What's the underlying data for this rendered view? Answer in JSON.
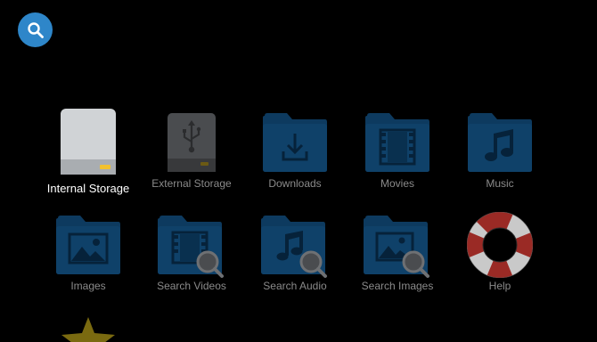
{
  "colors": {
    "background": "#000000",
    "search_button": "#2e86c9",
    "folder": "#0d3a5f",
    "folder_glyph": "#06223a",
    "label_dim": "#8a8a8a",
    "label_focused": "#ffffff",
    "star": "#7a6a10"
  },
  "toolbar": {
    "search_icon": "search-icon"
  },
  "tiles": [
    {
      "label": "Internal Storage",
      "icon": "internal-storage-icon",
      "focused": true
    },
    {
      "label": "External Storage",
      "icon": "usb-drive-icon"
    },
    {
      "label": "Downloads",
      "icon": "download-folder-icon"
    },
    {
      "label": "Movies",
      "icon": "movies-folder-icon"
    },
    {
      "label": "Music",
      "icon": "music-folder-icon"
    },
    {
      "label": "Images",
      "icon": "images-folder-icon"
    },
    {
      "label": "Search Videos",
      "icon": "search-videos-icon"
    },
    {
      "label": "Search Audio",
      "icon": "search-audio-icon"
    },
    {
      "label": "Search Images",
      "icon": "search-images-icon"
    },
    {
      "label": "Help",
      "icon": "lifebuoy-icon"
    },
    {
      "label": "",
      "icon": "star-icon"
    }
  ]
}
